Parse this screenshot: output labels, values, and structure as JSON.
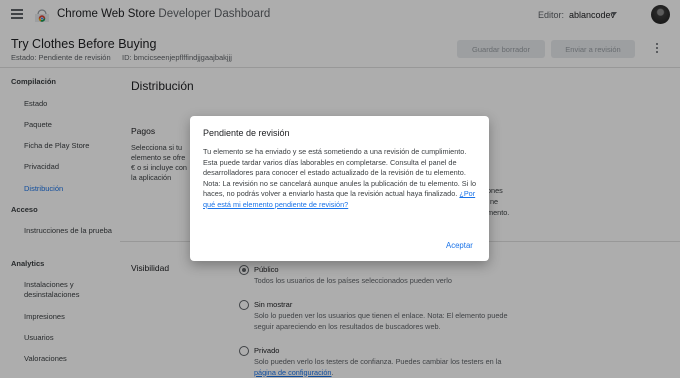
{
  "app": {
    "brand_primary": "Chrome Web Store",
    "brand_secondary": "Developer Dashboard",
    "editor_label": "Editor:",
    "editor_value": "ablancodev"
  },
  "header": {
    "item_title": "Try Clothes Before Buying",
    "status_label": "Estado: Pendiente de revisión",
    "id_label": "ID: bmcicseenjepflffindjjgaajbakjjj",
    "save_draft": "Guardar borrador",
    "submit_review": "Enviar a revisión"
  },
  "sidebar": {
    "sections": [
      {
        "title": "Compilación",
        "items": [
          "Estado",
          "Paquete",
          "Ficha de Play Store",
          "Privacidad",
          "Distribución"
        ]
      },
      {
        "title": "Acceso",
        "items": [
          "Instrucciones de la prueba"
        ]
      },
      {
        "title": "Analytics",
        "items": [
          "Instalaciones y desinstalaciones",
          "Impresiones",
          "Usuarios",
          "Valoraciones"
        ]
      }
    ],
    "active_item": "Distribución"
  },
  "main": {
    "title": "Distribución",
    "payments": {
      "title": "Pagos",
      "desc_lines": [
        "Selecciona si tu",
        "elemento se ofre",
        "€ o si incluye con",
        "la aplicación"
      ],
      "right_frag_1": "ones",
      "right_frag_2": "ne",
      "right_frag_3": "mento."
    },
    "visibility": {
      "title": "Visibilidad",
      "options": [
        {
          "title": "Público",
          "desc": "Todos los usuarios de los países seleccionados pueden verlo",
          "checked": true
        },
        {
          "title": "Sin mostrar",
          "desc": "Solo lo pueden ver los usuarios que tienen el enlace. Nota: El elemento puede seguir apareciendo en los resultados de buscadores web.",
          "checked": false
        },
        {
          "title": "Privado",
          "desc_prefix": "Solo pueden verlo los testers de confianza. Puedes cambiar los testers en la ",
          "desc_link": "página de configuración",
          "desc_suffix": ".",
          "checked": false
        }
      ]
    }
  },
  "dialog": {
    "title": "Pendiente de revisión",
    "para1": "Tu elemento se ha enviado y se está sometiendo a una revisión de cumplimiento. Esta puede tardar varios días laborables en completarse. Consulta el panel de desarrolladores para conocer el estado actualizado de la revisión de tu elemento.",
    "para2": "Nota: La revisión no se cancelará aunque anules la publicación de tu elemento. Si lo haces, no podrás volver a enviarlo hasta que la revisión actual haya finalizado. ",
    "link": "¿Por qué está mi elemento pendiente de revisión?",
    "accept": "Aceptar"
  },
  "colors": {
    "accent": "#1a73e8",
    "scrim": "rgba(0,0,0,0.32)"
  },
  "icons": [
    "menu-icon",
    "chrome-web-store-logo",
    "chevron-down-icon",
    "avatar",
    "more-vert-icon"
  ]
}
